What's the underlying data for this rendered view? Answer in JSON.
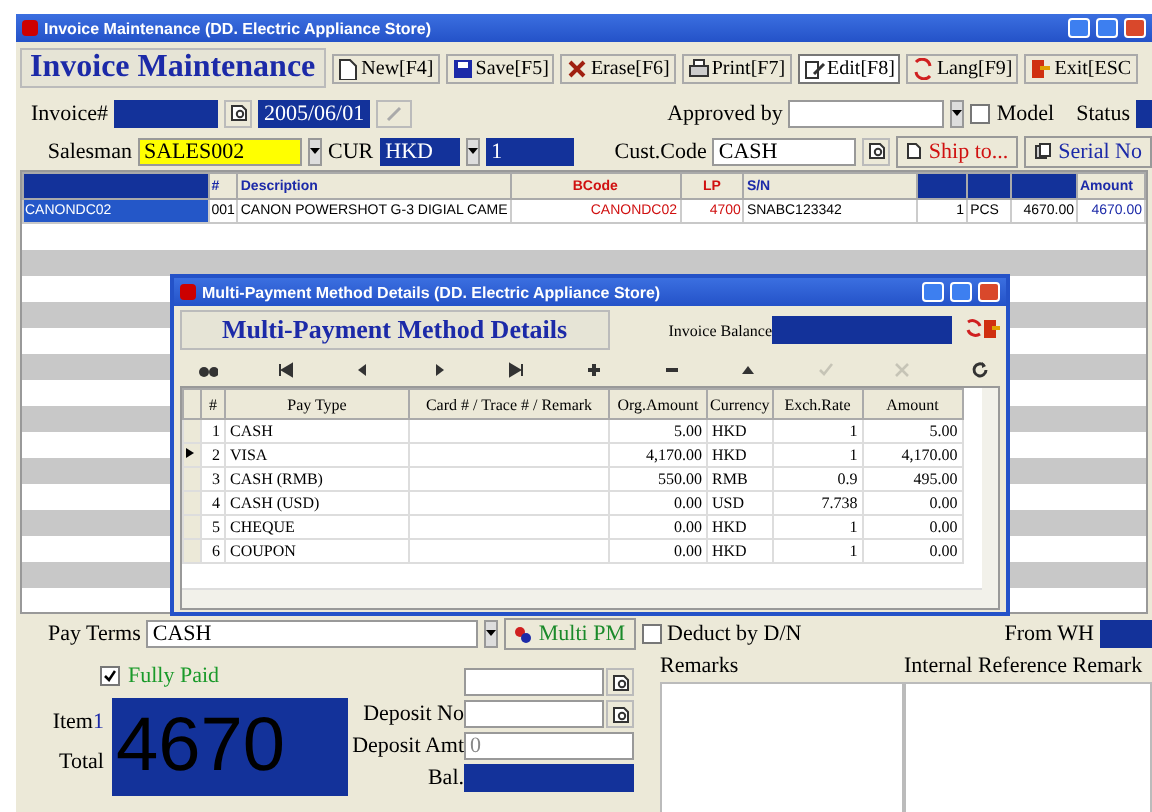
{
  "window": {
    "title": "Invoice Maintenance (DD. Electric Appliance Store)"
  },
  "heading": "Invoice Maintenance",
  "toolbar": [
    {
      "kind": "new",
      "label": "New[F4]",
      "selected": false
    },
    {
      "kind": "save",
      "label": "Save[F5]",
      "selected": false
    },
    {
      "kind": "erase",
      "label": "Erase[F6]",
      "selected": false
    },
    {
      "kind": "print",
      "label": "Print[F7]",
      "selected": false
    },
    {
      "kind": "edit",
      "label": "Edit[F8]",
      "selected": true
    },
    {
      "kind": "lang",
      "label": "Lang[F9]",
      "selected": false
    },
    {
      "kind": "exit",
      "label": "Exit[ESC",
      "selected": false
    }
  ],
  "header_form": {
    "invoice_label": "Invoice#",
    "date": "2005/06/01",
    "approved_by_label": "Approved by",
    "model": {
      "label": "Model",
      "checked": false
    },
    "status_label": "Status",
    "salesman_label": "Salesman",
    "salesman": "SALES002",
    "cur_label": "CUR",
    "currency": "HKD",
    "rate": "1",
    "cust_code_label": "Cust.Code",
    "cust_code": "CASH",
    "ship_to_button": "Ship to...",
    "serial_button": "Serial No"
  },
  "items_table": {
    "columns": [
      {
        "kind": "blank"
      },
      {
        "kind": "normal",
        "label": "#"
      },
      {
        "kind": "normal",
        "label": "Description"
      },
      {
        "kind": "required",
        "label": "BCode"
      },
      {
        "kind": "required",
        "label": "LP"
      },
      {
        "kind": "normal",
        "label": "S/N"
      },
      {
        "kind": "blank"
      },
      {
        "kind": "blank"
      },
      {
        "kind": "blank"
      },
      {
        "kind": "normal",
        "label": "Amount"
      }
    ],
    "rows": [
      {
        "cells": [
          "CANONDC02",
          "001",
          "CANON POWERSHOT G-3 DIGIAL CAME",
          "CANONDC02",
          "4700",
          "SNABC123342",
          "1",
          "PCS",
          "4670.00",
          "4670.00"
        ]
      }
    ]
  },
  "dialog": {
    "title": "Multi-Payment Method Details (DD. Electric Appliance Store)",
    "heading": "Multi-Payment Method Details",
    "balance_label": "Invoice Balance",
    "nav_buttons": [
      {
        "kind": "find",
        "disabled": false
      },
      {
        "kind": "first",
        "disabled": false
      },
      {
        "kind": "prev",
        "disabled": false
      },
      {
        "kind": "next",
        "disabled": false
      },
      {
        "kind": "last",
        "disabled": false
      },
      {
        "kind": "add",
        "disabled": false
      },
      {
        "kind": "delete",
        "disabled": false
      },
      {
        "kind": "up",
        "disabled": false
      },
      {
        "kind": "confirm",
        "disabled": true
      },
      {
        "kind": "cancel",
        "disabled": true
      },
      {
        "kind": "refresh",
        "disabled": false
      }
    ],
    "columns": [
      "#",
      "Pay Type",
      "Card # / Trace # / Remark",
      "Org.Amount",
      "Currency",
      "Exch.Rate",
      "Amount"
    ],
    "rows": [
      {
        "selected": false,
        "no": "1",
        "pay_type": "CASH",
        "org_amount": "5.00",
        "currency": "HKD",
        "exch_rate": "1",
        "amount": "5.00"
      },
      {
        "selected": true,
        "no": "2",
        "pay_type": "VISA",
        "org_amount": "4,170.00",
        "currency": "HKD",
        "exch_rate": "1",
        "amount": "4,170.00"
      },
      {
        "selected": false,
        "no": "3",
        "pay_type": "CASH (RMB)",
        "org_amount": "550.00",
        "currency": "RMB",
        "exch_rate": "0.9",
        "amount": "495.00"
      },
      {
        "selected": false,
        "no": "4",
        "pay_type": "CASH (USD)",
        "org_amount": "0.00",
        "currency": "USD",
        "exch_rate": "7.738",
        "amount": "0.00"
      },
      {
        "selected": false,
        "no": "5",
        "pay_type": "CHEQUE",
        "org_amount": "0.00",
        "currency": "HKD",
        "exch_rate": "1",
        "amount": "0.00"
      },
      {
        "selected": false,
        "no": "6",
        "pay_type": "COUPON",
        "org_amount": "0.00",
        "currency": "HKD",
        "exch_rate": "1",
        "amount": "0.00"
      }
    ]
  },
  "footer": {
    "pay_terms_label": "Pay Terms",
    "pay_terms": "CASH",
    "multi_pm_button": "Multi PM",
    "deduct": {
      "label": "Deduct by D/N",
      "checked": false
    },
    "from_wh_label": "From WH",
    "fully_paid": {
      "label": "Fully Paid",
      "checked": true
    },
    "item_label": "Item",
    "item_count": "1",
    "total_label": "Total",
    "total": "4670",
    "deposit_no_label": "Deposit No",
    "deposit_amt_label": "Deposit Amt",
    "deposit_amt": "0",
    "bal_label": "Bal.",
    "remarks_label": "Remarks",
    "internal_label": "Internal Reference Remark"
  }
}
